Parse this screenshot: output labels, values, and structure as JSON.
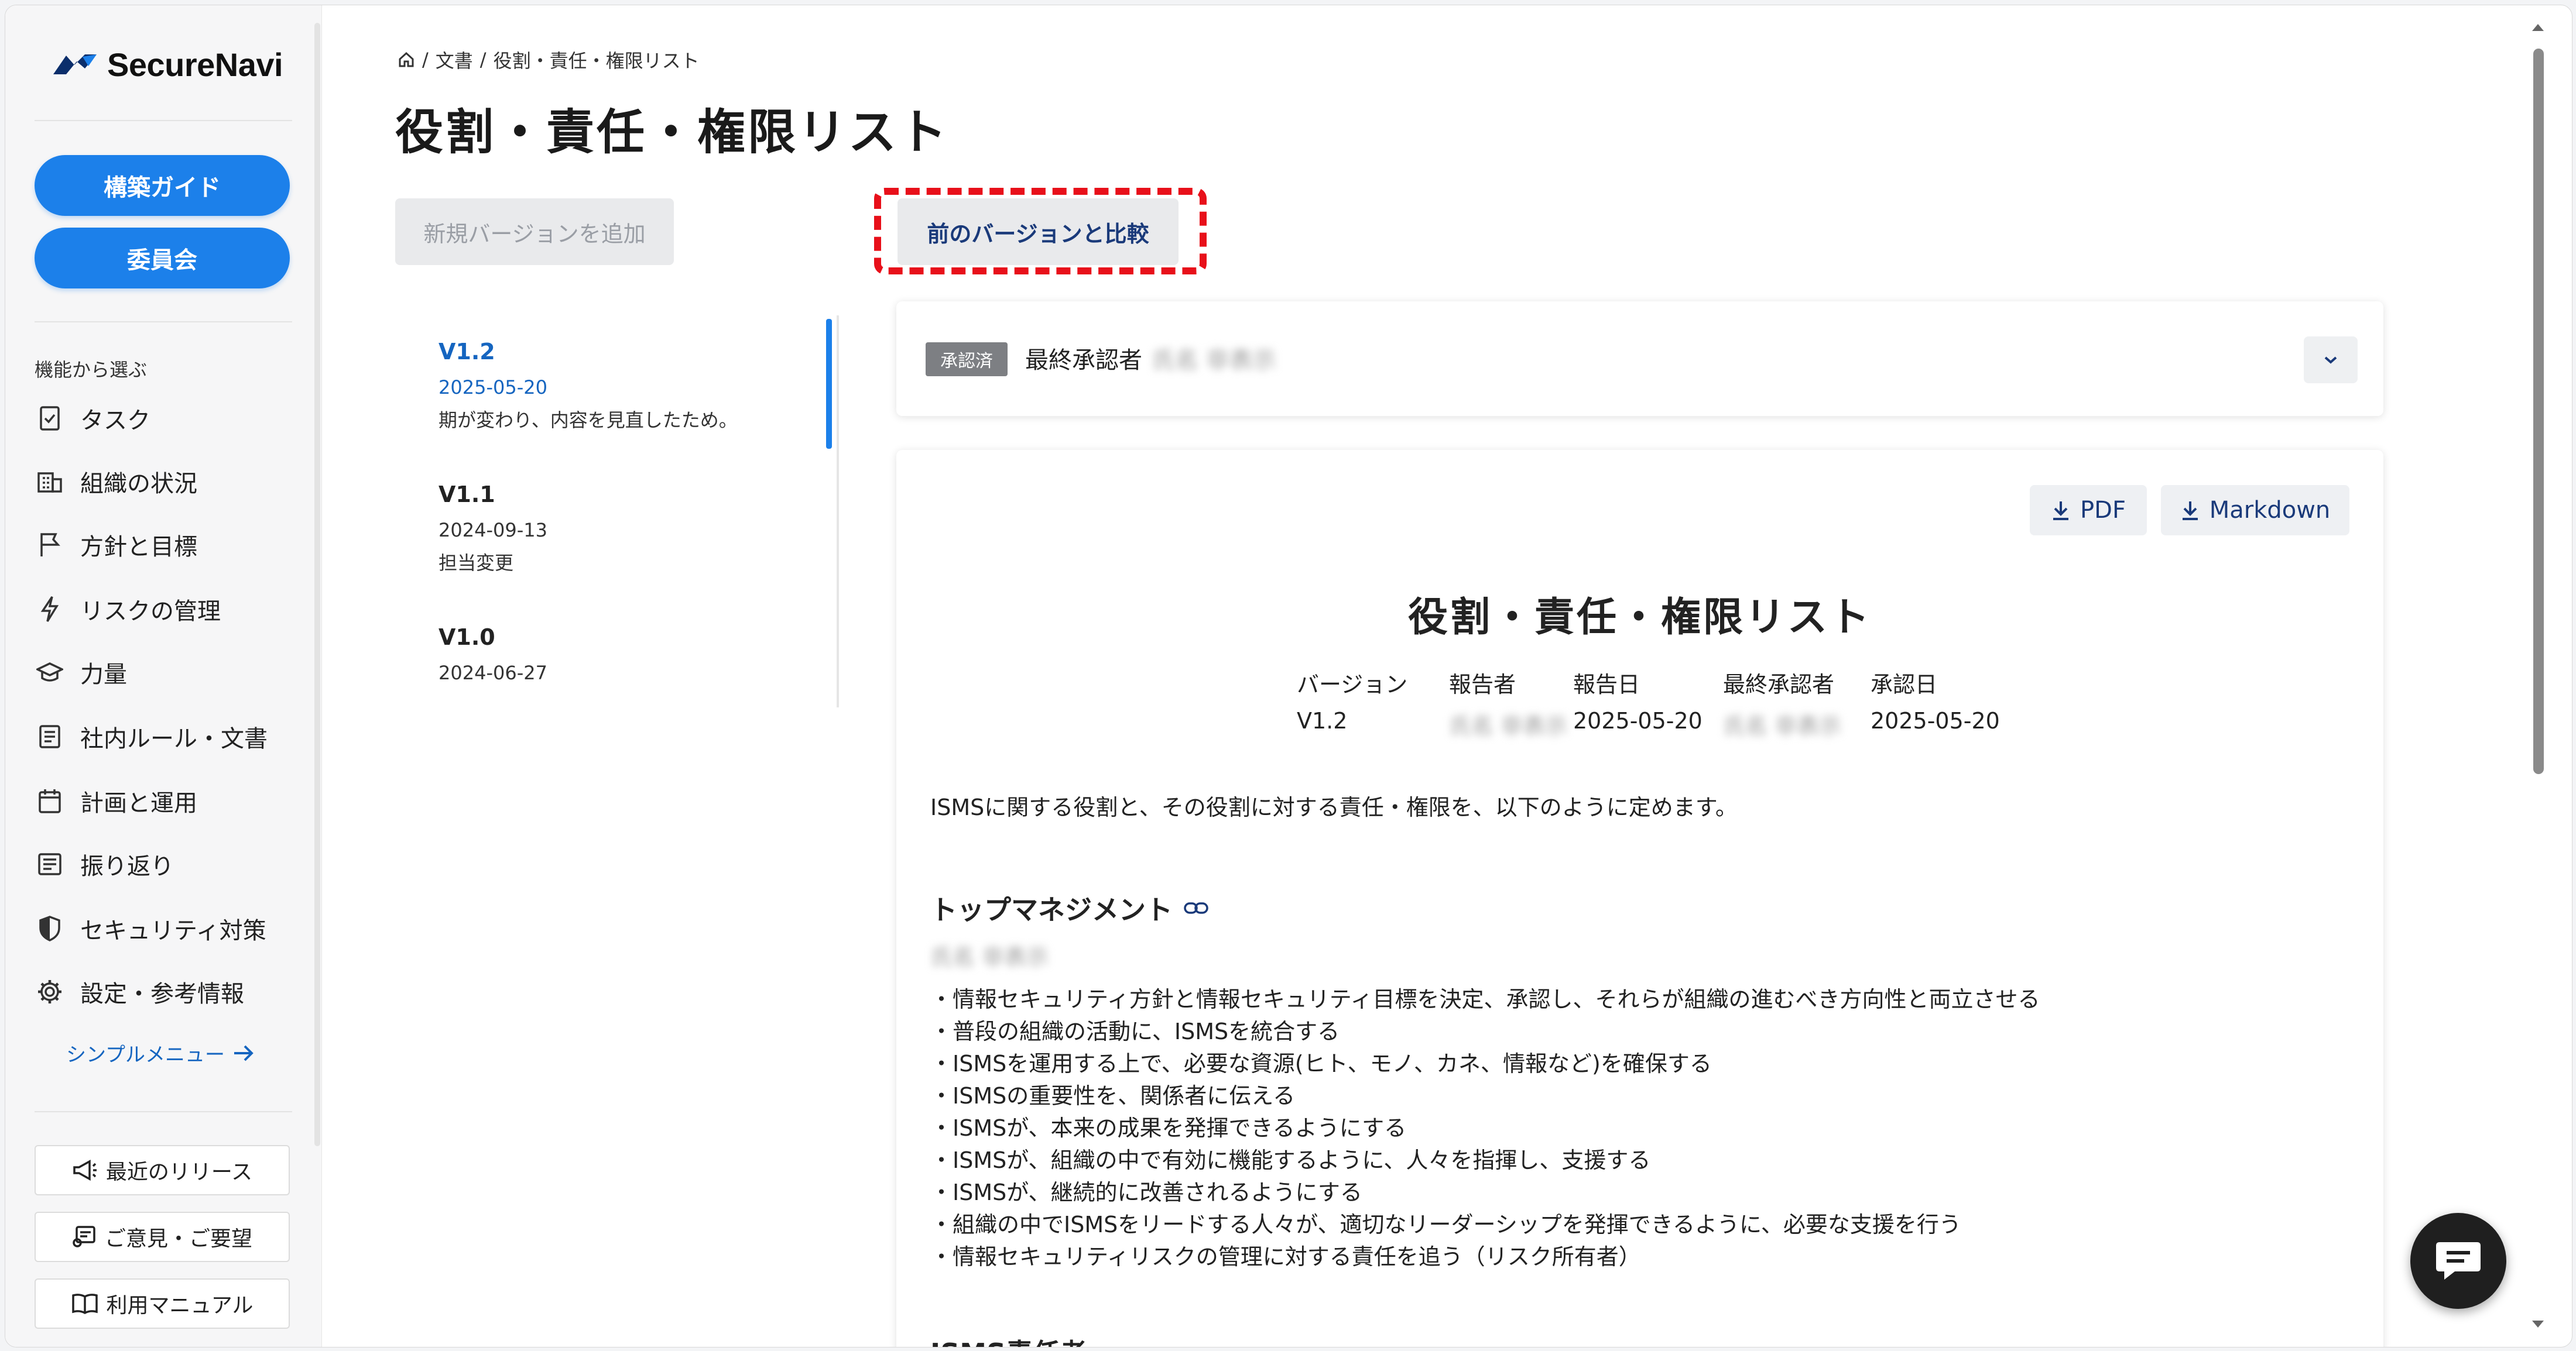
{
  "brand": {
    "name": "SecureNavi"
  },
  "sidebar": {
    "primary_buttons": [
      "構築ガイド",
      "委員会"
    ],
    "section_label": "機能から選ぶ",
    "items": [
      {
        "label": "タスク",
        "icon": "task-check-icon"
      },
      {
        "label": "組織の状況",
        "icon": "building-icon"
      },
      {
        "label": "方針と目標",
        "icon": "flag-icon"
      },
      {
        "label": "リスクの管理",
        "icon": "lightning-icon"
      },
      {
        "label": "力量",
        "icon": "graduation-cap-icon"
      },
      {
        "label": "社内ルール・文書",
        "icon": "document-icon"
      },
      {
        "label": "計画と運用",
        "icon": "calendar-icon"
      },
      {
        "label": "振り返り",
        "icon": "notes-icon"
      },
      {
        "label": "セキュリティ対策",
        "icon": "shield-icon"
      },
      {
        "label": "設定・参考情報",
        "icon": "gear-icon"
      }
    ],
    "simple_menu": "シンプルメニュー",
    "footer_buttons": [
      {
        "label": "最近のリリース",
        "icon": "megaphone-icon"
      },
      {
        "label": "ご意見・ご要望",
        "icon": "feedback-icon"
      },
      {
        "label": "利用マニュアル",
        "icon": "book-icon"
      }
    ]
  },
  "breadcrumb": {
    "items": [
      "文書",
      "役割・責任・権限リスト"
    ]
  },
  "page": {
    "title": "役割・責任・権限リスト",
    "add_version": "新規バージョンを追加",
    "compare": "前のバージョンと比較"
  },
  "versions": [
    {
      "name": "V1.2",
      "date": "2025-05-20",
      "note": "期が変わり、内容を見直したため。"
    },
    {
      "name": "V1.1",
      "date": "2024-09-13",
      "note": "担当変更"
    },
    {
      "name": "V1.0",
      "date": "2024-06-27",
      "note": ""
    }
  ],
  "approval": {
    "badge": "承認済",
    "label": "最終承認者",
    "name": "氏名 非表示"
  },
  "document": {
    "download": [
      "PDF",
      "Markdown"
    ],
    "title": "役割・責任・権限リスト",
    "meta": [
      {
        "label": "バージョン",
        "value": "V1.2"
      },
      {
        "label": "報告者",
        "value": "氏名 非表示"
      },
      {
        "label": "報告日",
        "value": "2025-05-20"
      },
      {
        "label": "最終承認者",
        "value": "氏名 非表示"
      },
      {
        "label": "承認日",
        "value": "2025-05-20"
      }
    ],
    "intro": "ISMSに関する役割と、その役割に対する責任・権限を、以下のように定めます。",
    "section_title": "トップマネジメント",
    "section_person": "氏名 非表示",
    "responsibilities": [
      "・情報セキュリティ方針と情報セキュリティ目標を決定、承認し、それらが組織の進むべき方向性と両立させる",
      "・普段の組織の活動に、ISMSを統合する",
      "・ISMSを運用する上で、必要な資源(ヒト、モノ、カネ、情報など)を確保する",
      "・ISMSの重要性を、関係者に伝える",
      "・ISMSが、本来の成果を発揮できるようにする",
      "・ISMSが、組織の中で有効に機能するように、人々を指揮し、支援する",
      "・ISMSが、継続的に改善されるようにする",
      "・組織の中でISMSをリードする人々が、適切なリーダーシップを発揮できるように、必要な支援を行う",
      "・情報セキュリティリスクの管理に対する責任を追う（リスク所有者）"
    ],
    "next_section_title": "ISMS責任者"
  },
  "colors": {
    "accent": "#1c80ea",
    "highlight": "#e8101a",
    "badge": "#7d7f83"
  }
}
